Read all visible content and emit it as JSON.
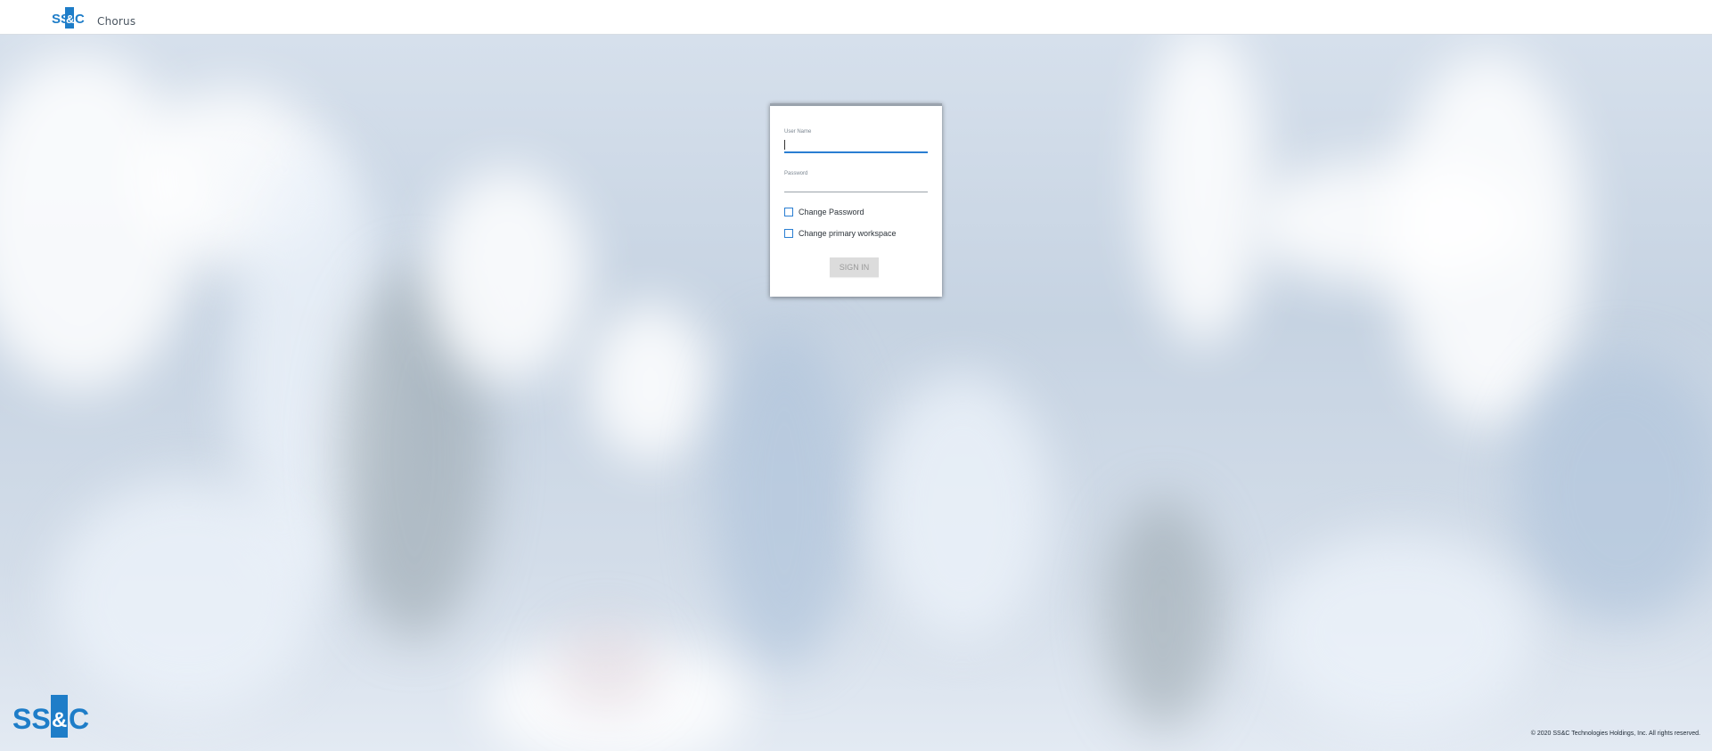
{
  "header": {
    "logo_text": "SS&C",
    "app_name": "Chorus"
  },
  "login": {
    "username_label": "User Name",
    "username_value": "",
    "password_label": "Password",
    "password_value": "",
    "change_password_label": "Change Password",
    "change_password_checked": false,
    "change_workspace_label": "Change primary workspace",
    "change_workspace_checked": false,
    "sign_in_label": "SIGN IN",
    "sign_in_enabled": false
  },
  "footer": {
    "logo_text": "SS&C",
    "copyright": "© 2020 SS&C Technologies Holdings, Inc. All rights reserved."
  },
  "colors": {
    "brand_blue": "#1e7dc8",
    "focus_underline": "#2a7ed2",
    "button_disabled_bg": "#dcdcdc",
    "button_disabled_text": "#9a9a9a"
  }
}
